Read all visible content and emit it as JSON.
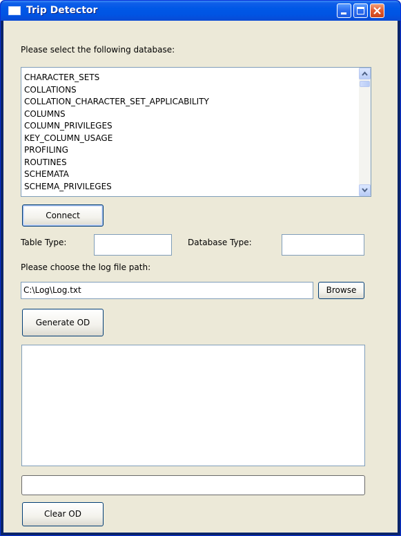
{
  "window": {
    "title": "Trip Detector"
  },
  "database_prompt": "Please select the following database:",
  "database_list": [
    "CHARACTER_SETS",
    "COLLATIONS",
    "COLLATION_CHARACTER_SET_APPLICABILITY",
    "COLUMNS",
    "COLUMN_PRIVILEGES",
    "KEY_COLUMN_USAGE",
    "PROFILING",
    "ROUTINES",
    "SCHEMATA",
    "SCHEMA_PRIVILEGES"
  ],
  "connect_label": "Connect",
  "table_type_label": "Table Type:",
  "table_type_value": "",
  "database_type_label": "Database Type:",
  "database_type_value": "",
  "log_path_prompt": "Please choose the log file path:",
  "log_path_value": "C:\\Log\\Log.txt",
  "browse_label": "Browse",
  "generate_label": "Generate OD",
  "output_text": "",
  "progress_value": 0,
  "clear_label": "Clear OD",
  "colors": {
    "titlebar": "#0054e3",
    "window_bg": "#ece9d8",
    "border": "#7f9db9"
  },
  "icons": [
    "app-window-icon",
    "minimize-icon",
    "maximize-icon",
    "close-icon",
    "scroll-up-arrow-icon",
    "scroll-down-arrow-icon"
  ]
}
